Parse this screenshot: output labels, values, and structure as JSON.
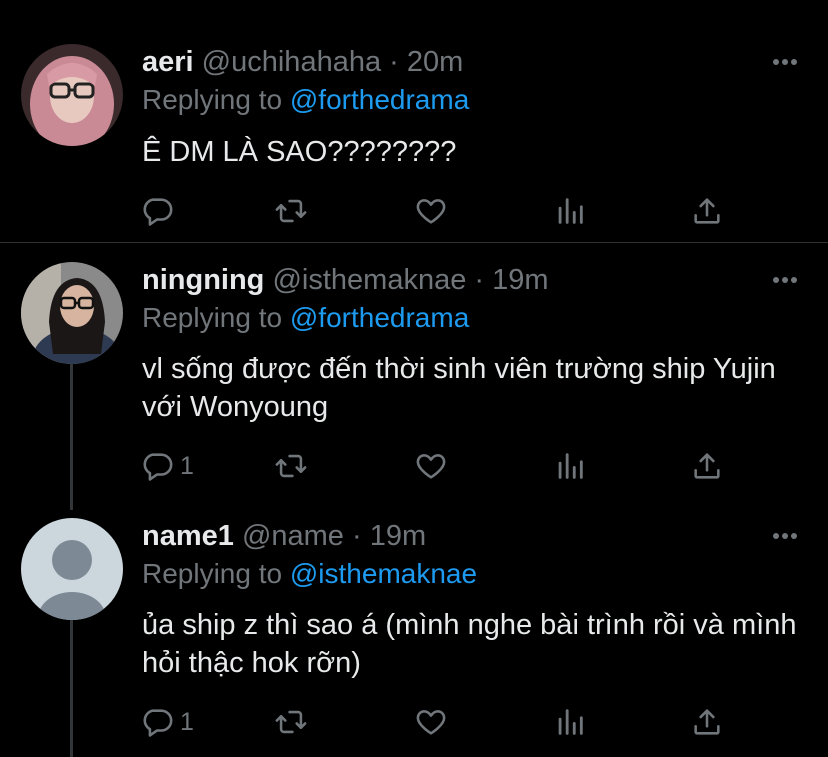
{
  "tweets": [
    {
      "name": "aeri",
      "handle": "@uchihahaha",
      "separator": "·",
      "time": "20m",
      "replying_prefix": "Replying to",
      "replying_to": "@forthedrama",
      "text": "Ê DM LÀ SAO????????",
      "reply_count": "",
      "avatar": "avatar-pink-hair-glasses"
    },
    {
      "name": "ningning",
      "handle": "@isthemaknae",
      "separator": "·",
      "time": "19m",
      "replying_prefix": "Replying to",
      "replying_to": "@forthedrama",
      "text": "vl sống được đến thời sinh viên trường ship Yujin với Wonyoung",
      "reply_count": "1",
      "avatar": "avatar-glasses-denim-jacket"
    },
    {
      "name": "name1",
      "handle": "@name",
      "separator": "·",
      "time": "19m",
      "replying_prefix": "Replying to",
      "replying_to": "@isthemaknae",
      "text": "ủa ship z thì sao á (mình nghe bài trình rồi và mình hỏi thậc hok rỡn)",
      "reply_count": "1",
      "avatar": "avatar-default-person"
    }
  ],
  "icons": {
    "reply": "reply-icon",
    "retweet": "retweet-icon",
    "like": "like-icon",
    "analytics": "analytics-icon",
    "share": "share-icon",
    "more": "more-icon"
  },
  "colors": {
    "background": "#000000",
    "text": "#e7e9ea",
    "secondary": "#71767b",
    "link": "#1d9bf0",
    "divider": "#2f3336"
  }
}
